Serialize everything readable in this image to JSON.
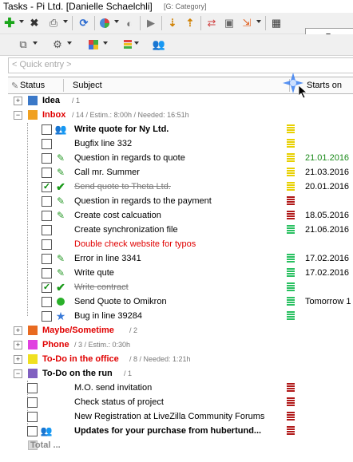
{
  "title": {
    "main": "Tasks - Pi Ltd. [Danielle Schaelchli]",
    "category": "[G: Category]"
  },
  "quick_entry": {
    "placeholder": "< Quick entry >"
  },
  "columns": {
    "status": "Status",
    "subject": "Subject",
    "starts_on": "Starts on"
  },
  "colors": {
    "prio_yellow": "#e8d000",
    "prio_red": "#b01818",
    "prio_green": "#28c060",
    "date_green": "#1a8a1a",
    "overdue_red": "#e00000"
  },
  "groups": {
    "idea": {
      "name": "Idea",
      "info": "/ 1",
      "color": "#3a78c8"
    },
    "inbox": {
      "name": "Inbox",
      "info": "/ 14 / Estim.: 8:00h / Needed: 16:51h",
      "color": "#f0a020"
    },
    "maybe": {
      "name": "Maybe/Sometime",
      "info": "/ 2",
      "color": "#e86a20"
    },
    "phone": {
      "name": "Phone",
      "info": "/ 3 / Estim.: 0:30h",
      "color": "#e040e0"
    },
    "office": {
      "name": "To-Do in the office",
      "info": "/ 8 / Needed: 1:21h",
      "color": "#f0e020"
    },
    "run": {
      "name": "To-Do on the run",
      "info": "/ 1",
      "color": "#8060c0"
    }
  },
  "inbox_tasks": [
    {
      "subject": "Write quote for Ny Ltd.",
      "date": "",
      "status_icon": "people-icon",
      "checked": false,
      "prio": "yellow"
    },
    {
      "subject": "Bugfix line 332",
      "date": "",
      "status_icon": "",
      "checked": false,
      "prio": "yellow"
    },
    {
      "subject": "Question in regards to quote",
      "date": "21.01.2016",
      "status_icon": "note-icon",
      "checked": false,
      "prio": "yellow"
    },
    {
      "subject": "Call mr. Summer",
      "date": "21.03.2016",
      "status_icon": "note-icon",
      "checked": false,
      "prio": "yellow"
    },
    {
      "subject": "Send quote to Theta Ltd.",
      "date": "20.01.2016",
      "status_icon": "check-icon",
      "checked": true,
      "prio": "yellow"
    },
    {
      "subject": "Question in regards to the payment",
      "date": "",
      "status_icon": "note-icon",
      "checked": false,
      "prio": "red"
    },
    {
      "subject": "Create cost calcuation",
      "date": "18.05.2016",
      "status_icon": "note-icon",
      "checked": false,
      "prio": "red"
    },
    {
      "subject": "Create synchronization file",
      "date": "21.06.2016",
      "status_icon": "",
      "checked": false,
      "prio": "green"
    },
    {
      "subject": "Double check website for typos",
      "date": "",
      "status_icon": "",
      "checked": false,
      "prio": ""
    },
    {
      "subject": "Error in line 3341",
      "date": "17.02.2016",
      "status_icon": "note-icon",
      "checked": false,
      "prio": "green"
    },
    {
      "subject": "Write qute",
      "date": "17.02.2016",
      "status_icon": "note-icon",
      "checked": false,
      "prio": "green"
    },
    {
      "subject": "Write contract",
      "date": "",
      "status_icon": "check-icon",
      "checked": true,
      "prio": "green"
    },
    {
      "subject": "Send Quote to Omikron",
      "date": "Tomorrow 1",
      "status_icon": "green-dot-icon",
      "checked": false,
      "prio": "green"
    },
    {
      "subject": "Bug in line 39284",
      "date": "",
      "status_icon": "star-icon",
      "checked": false,
      "prio": "green"
    }
  ],
  "run_tasks": [
    {
      "subject": "M.O. send invitation",
      "prio": "red"
    },
    {
      "subject": "Check status of project",
      "prio": "red"
    },
    {
      "subject": "New Registration at LiveZilla Community Forums",
      "prio": "red"
    },
    {
      "subject": "Updates for your purchase from hubertund...",
      "prio": "red"
    }
  ],
  "total_label": "Total ..."
}
